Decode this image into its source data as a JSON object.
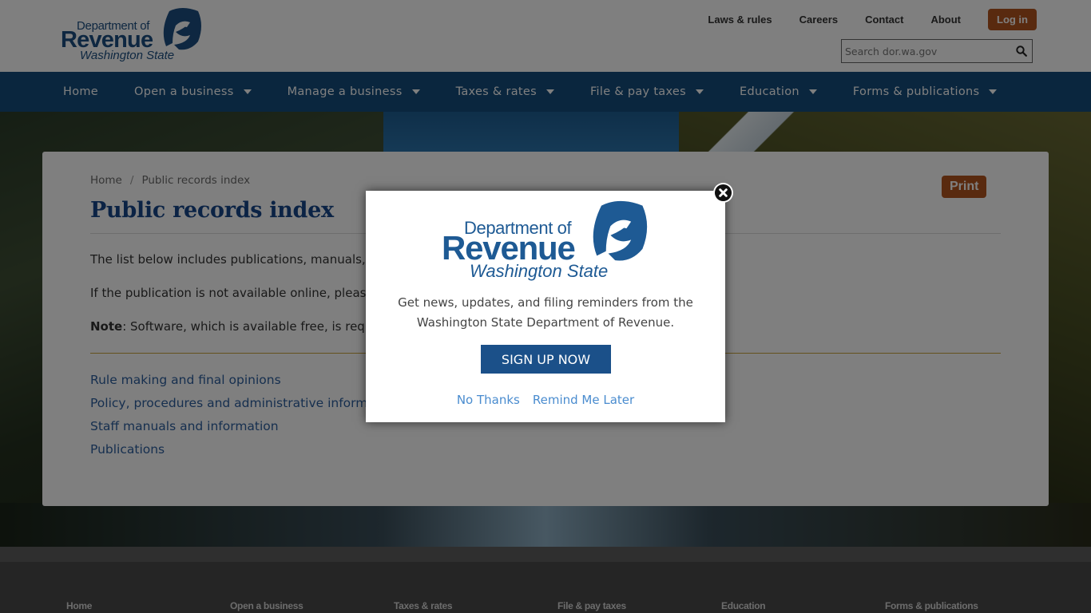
{
  "header": {
    "logo": {
      "line1": "Department of",
      "line2": "Revenue",
      "line3": "Washington State"
    },
    "utility_links": [
      "Laws & rules",
      "Careers",
      "Contact",
      "About"
    ],
    "login_label": "Log in",
    "search": {
      "placeholder": "Search dor.wa.gov",
      "value": ""
    }
  },
  "main_nav": [
    {
      "label": "Home",
      "has_dropdown": false
    },
    {
      "label": "Open a business",
      "has_dropdown": true
    },
    {
      "label": "Manage a business",
      "has_dropdown": true
    },
    {
      "label": "Taxes & rates",
      "has_dropdown": true
    },
    {
      "label": "File & pay taxes",
      "has_dropdown": true
    },
    {
      "label": "Education",
      "has_dropdown": true
    },
    {
      "label": "Forms & publications",
      "has_dropdown": true
    }
  ],
  "breadcrumb": {
    "items": [
      "Home",
      "Public records index"
    ],
    "separator": "/"
  },
  "page": {
    "title": "Public records index",
    "print_label": "Print",
    "para1": "The list below includes publications, manuals,",
    "para2": "If the publication is not available online, please",
    "note_label": "Note",
    "note_text": ": Software, which is available free, is requ",
    "links": [
      "Rule making and final opinions",
      "Policy, procedures and administrative information",
      "Staff manuals and information",
      "Publications"
    ]
  },
  "footer": {
    "links": [
      "Home",
      "Open a business",
      "Taxes & rates",
      "File & pay taxes",
      "Education",
      "Forms & publications"
    ]
  },
  "modal": {
    "logo": {
      "line1": "Department of",
      "line2": "Revenue",
      "line3": "Washington State"
    },
    "message_line1": "Get news, updates, and filing reminders from the",
    "message_line2": "Washington State Department of Revenue.",
    "signup_label": "SIGN UP NOW",
    "no_thanks_label": "No Thanks",
    "remind_label": "Remind Me Later"
  },
  "colors": {
    "brand_blue": "#144c7c",
    "accent_orange": "#b3541e",
    "link_blue": "#2c5e9e",
    "gold_rule": "#c8a23a"
  }
}
